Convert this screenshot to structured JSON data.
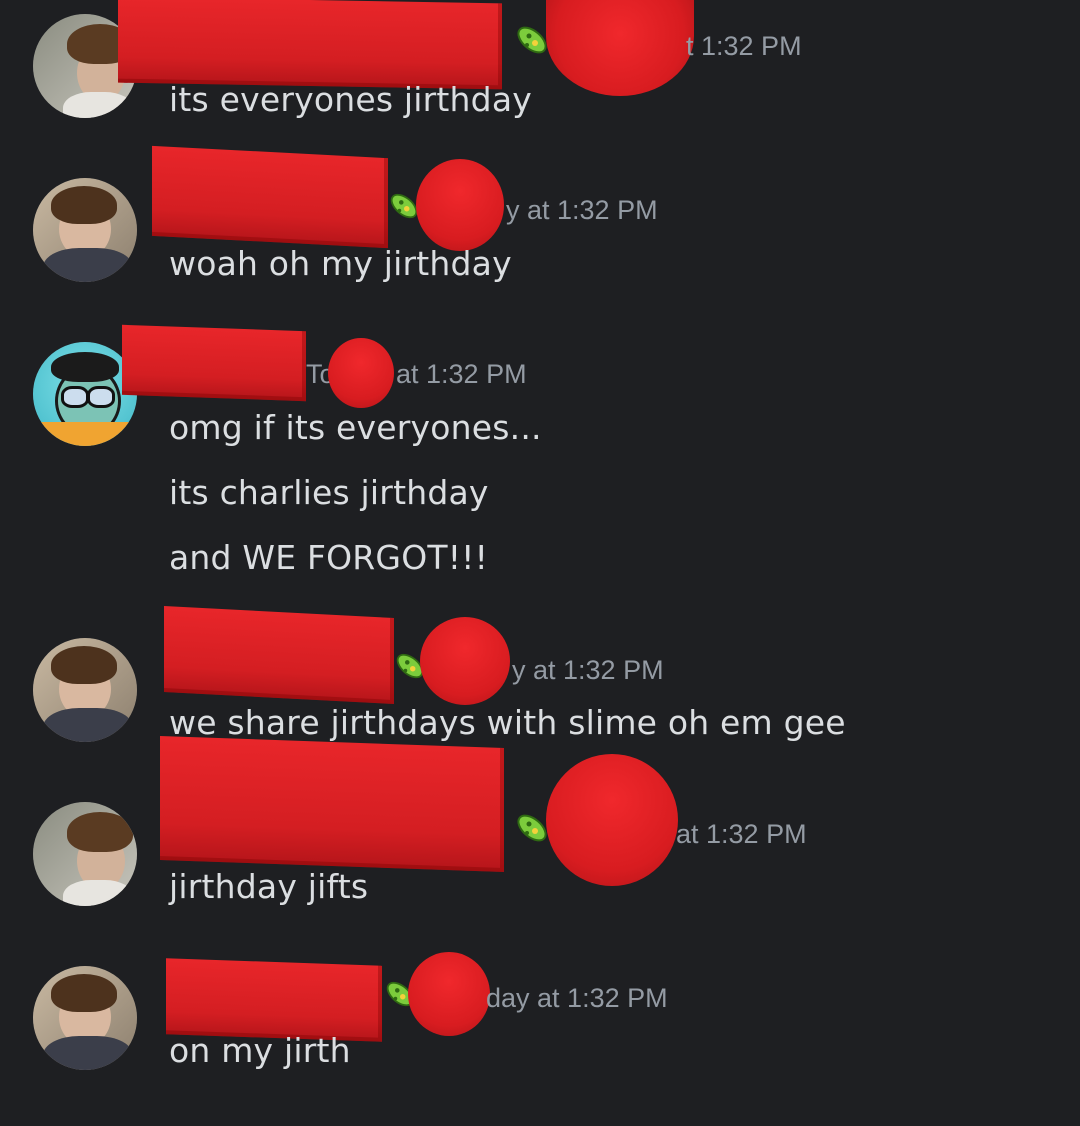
{
  "messages": [
    {
      "timestamp_fragment": "t 1:32 PM",
      "lines": [
        "its everyones jirthday"
      ]
    },
    {
      "timestamp_fragment": "y at 1:32 PM",
      "lines": [
        "woah oh my jirthday"
      ]
    },
    {
      "timestamp_fragment_left": "To",
      "timestamp_fragment": "at 1:32 PM",
      "lines": [
        "omg if its everyones...",
        "its charlies jirthday",
        "and WE FORGOT!!!"
      ]
    },
    {
      "timestamp_fragment": "y at 1:32 PM",
      "lines": [
        "we share jirthdays with slime oh em gee"
      ]
    },
    {
      "timestamp_fragment": "at 1:32 PM",
      "lines": [
        "jirthday jifts"
      ]
    },
    {
      "timestamp_fragment": "day at 1:32 PM",
      "lines": [
        "on my jirth"
      ]
    }
  ],
  "icons": {
    "badge": "microbe-icon",
    "avatar_a": "user-avatar-photo",
    "avatar_b": "user-avatar-cartoon"
  },
  "colors": {
    "background": "#1e1f22",
    "message_text": "#dbdee1",
    "timestamp_text": "#949ba4",
    "redaction": "#d81c20"
  }
}
